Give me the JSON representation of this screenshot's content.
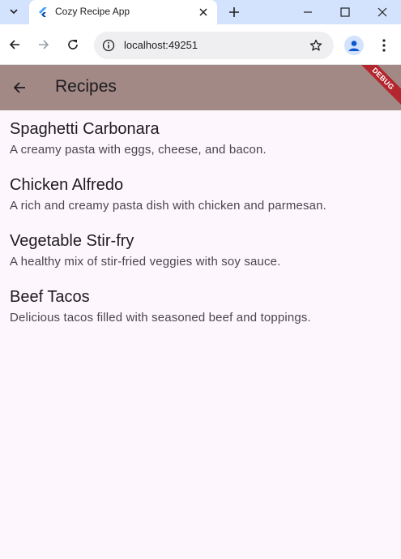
{
  "browser": {
    "tab": {
      "title": "Cozy Recipe App"
    },
    "address": {
      "url": "localhost:49251"
    }
  },
  "appbar": {
    "title": "Recipes",
    "debug_label": "DEBUG"
  },
  "recipes": [
    {
      "title": "Spaghetti Carbonara",
      "description": "A creamy pasta with eggs, cheese, and bacon."
    },
    {
      "title": "Chicken Alfredo",
      "description": "A rich and creamy pasta dish with chicken and parmesan."
    },
    {
      "title": "Vegetable Stir-fry",
      "description": "A healthy mix of stir-fried veggies with soy sauce."
    },
    {
      "title": "Beef Tacos",
      "description": "Delicious tacos filled with seasoned beef and toppings."
    }
  ],
  "colors": {
    "appbar_background": "#a28985",
    "page_background": "#fdf6fd",
    "debug_banner": "#b3262e",
    "tabstrip": "#d3e3fd"
  }
}
